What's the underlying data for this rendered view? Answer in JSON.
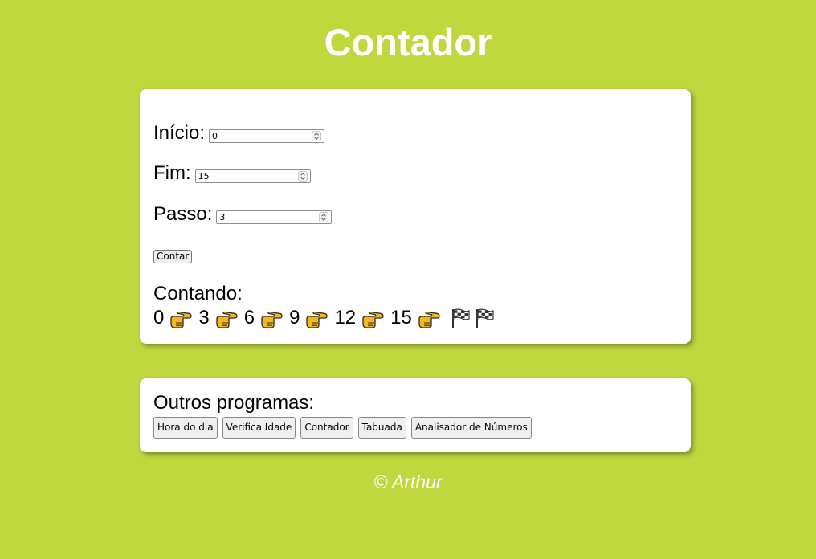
{
  "header": {
    "title": "Contador"
  },
  "form": {
    "start": {
      "label": "Início:",
      "value": "0"
    },
    "end": {
      "label": "Fim:",
      "value": "15"
    },
    "step": {
      "label": "Passo:",
      "value": "3"
    },
    "count_button": "Contar"
  },
  "result": {
    "label": "Contando:",
    "sequence": [
      "0",
      "3",
      "6",
      "9",
      "12",
      "15"
    ],
    "separator_icon": "pointing-hand-icon",
    "end_icon": "checkered-flag-icon"
  },
  "other_programs": {
    "title": "Outros programas:",
    "buttons": [
      "Hora do dia",
      "Verifica Idade",
      "Contador",
      "Tabuada",
      "Analisador de Números"
    ]
  },
  "footer": {
    "text": "© Arthur"
  },
  "colors": {
    "background": "#bfd83e",
    "card": "#ffffff",
    "heading": "#ffffff"
  }
}
